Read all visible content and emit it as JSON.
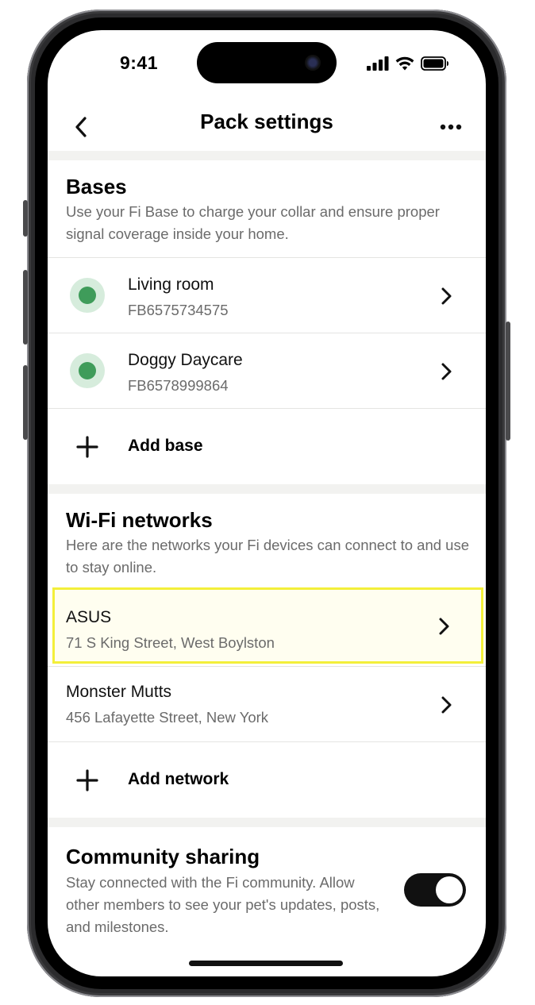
{
  "status_bar": {
    "time": "9:41"
  },
  "nav": {
    "title": "Pack settings"
  },
  "bases": {
    "title": "Bases",
    "description": "Use your Fi Base to charge your collar and ensure proper signal coverage inside your home.",
    "items": [
      {
        "name": "Living room",
        "id": "FB6575734575",
        "status_color": "#3f9c5a"
      },
      {
        "name": "Doggy Daycare",
        "id": "FB6578999864",
        "status_color": "#3f9c5a"
      }
    ],
    "add_label": "Add base"
  },
  "wifi": {
    "title": "Wi-Fi networks",
    "description": "Here are the networks your Fi devices can connect to and use to stay online.",
    "items": [
      {
        "name": "ASUS",
        "address": "71 S King Street, West Boylston",
        "highlighted": true
      },
      {
        "name": "Monster Mutts",
        "address": "456 Lafayette Street, New York",
        "highlighted": false
      }
    ],
    "add_label": "Add network"
  },
  "community": {
    "title": "Community sharing",
    "description": "Stay connected with the Fi community. Allow other members to see your pet's updates, posts, and milestones.",
    "toggle_on": true
  },
  "colors": {
    "highlight_border": "#f3ef3a",
    "highlight_bg": "#fffef0",
    "band": "#f2f2f0"
  }
}
